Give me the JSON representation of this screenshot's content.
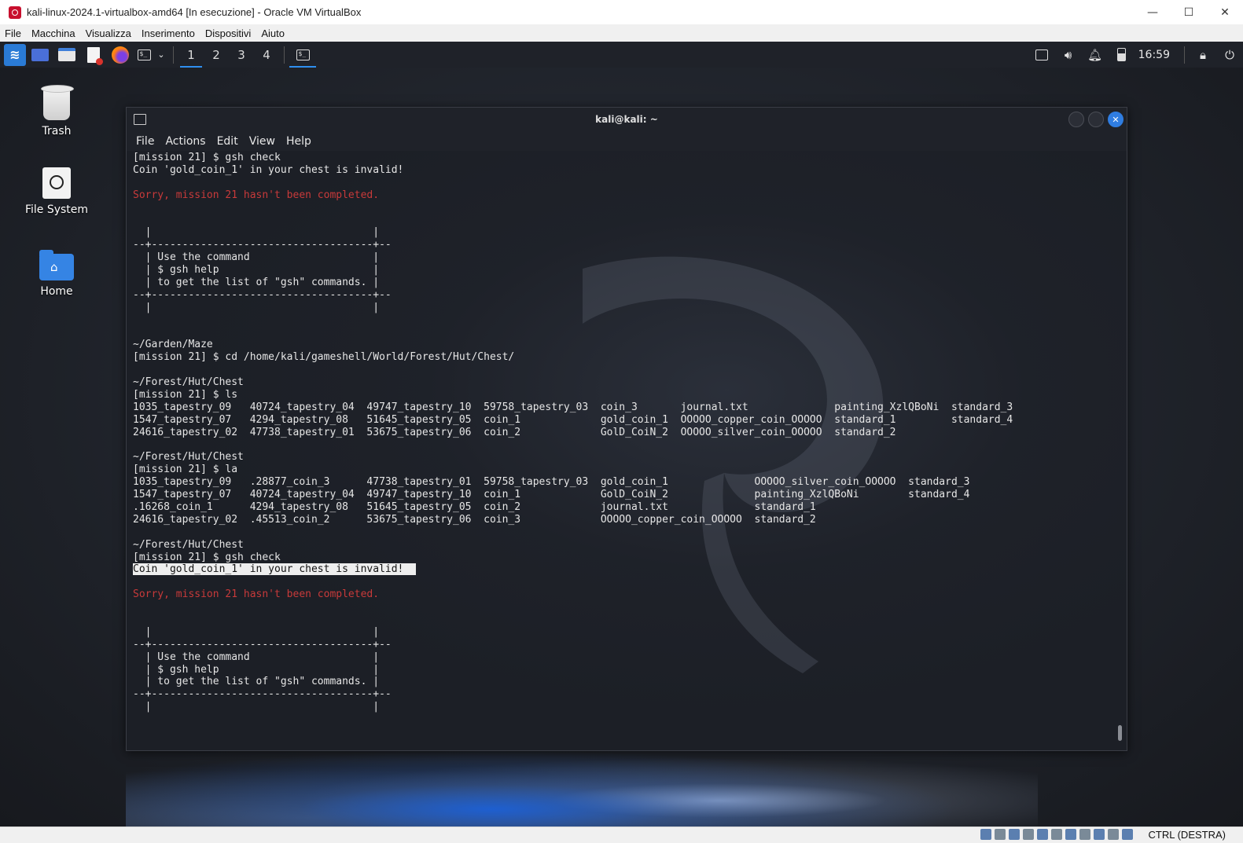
{
  "host_window": {
    "title": "kali-linux-2024.1-virtualbox-amd64 [In esecuzione] - Oracle VM VirtualBox",
    "controls": {
      "minimize": "—",
      "maximize": "☐",
      "close": "✕"
    },
    "menu": [
      "File",
      "Macchina",
      "Visualizza",
      "Inserimento",
      "Dispositivi",
      "Aiuto"
    ]
  },
  "panel": {
    "workspaces": [
      "1",
      "2",
      "3",
      "4"
    ],
    "active_workspace": "1",
    "clock": "16:59",
    "launchers": [
      "kali-menu-icon",
      "desktop-icon",
      "file-manager-icon",
      "text-editor-icon",
      "firefox-icon",
      "terminal-icon"
    ],
    "tray": [
      "network-icon",
      "volume-icon",
      "notifications-icon",
      "battery-icon",
      "lock-icon",
      "logout-icon"
    ]
  },
  "desktop_icons": [
    {
      "label": "Trash",
      "icon": "trash-icon"
    },
    {
      "label": "File System",
      "icon": "drive-icon"
    },
    {
      "label": "Home",
      "icon": "home-folder-icon"
    }
  ],
  "terminal": {
    "title": "kali@kali: ~",
    "menu": [
      "File",
      "Actions",
      "Edit",
      "View",
      "Help"
    ],
    "lines": [
      {
        "text": "[mission 21] $ gsh check"
      },
      {
        "text": "Coin 'gold_coin_1' in your chest is invalid!"
      },
      {
        "text": ""
      },
      {
        "text": "Sorry, mission 21 hasn't been completed.",
        "style": "red"
      },
      {
        "text": ""
      },
      {
        "text": ""
      },
      {
        "text": "  |                                    |"
      },
      {
        "text": "--+------------------------------------+--"
      },
      {
        "text": "  | Use the command                    |"
      },
      {
        "text": "  | $ gsh help                         |"
      },
      {
        "text": "  | to get the list of \"gsh\" commands. |"
      },
      {
        "text": "--+------------------------------------+--"
      },
      {
        "text": "  |                                    |"
      },
      {
        "text": ""
      },
      {
        "text": ""
      },
      {
        "text": "~/Garden/Maze"
      },
      {
        "text": "[mission 21] $ cd /home/kali/gameshell/World/Forest/Hut/Chest/"
      },
      {
        "text": ""
      },
      {
        "text": "~/Forest/Hut/Chest"
      },
      {
        "text": "[mission 21] $ ls"
      },
      {
        "text": "1035_tapestry_09   40724_tapestry_04  49747_tapestry_10  59758_tapestry_03  coin_3       journal.txt              painting_XzlQBoNi  standard_3"
      },
      {
        "text": "1547_tapestry_07   4294_tapestry_08   51645_tapestry_05  coin_1             gold_coin_1  OOOOO_copper_coin_OOOOO  standard_1         standard_4"
      },
      {
        "text": "24616_tapestry_02  47738_tapestry_01  53675_tapestry_06  coin_2             GolD_CoiN_2  OOOOO_silver_coin_OOOOO  standard_2"
      },
      {
        "text": ""
      },
      {
        "text": "~/Forest/Hut/Chest"
      },
      {
        "text": "[mission 21] $ la"
      },
      {
        "text": "1035_tapestry_09   .28877_coin_3      47738_tapestry_01  59758_tapestry_03  gold_coin_1              OOOOO_silver_coin_OOOOO  standard_3"
      },
      {
        "text": "1547_tapestry_07   40724_tapestry_04  49747_tapestry_10  coin_1             GolD_CoiN_2              painting_XzlQBoNi        standard_4"
      },
      {
        "text": ".16268_coin_1      4294_tapestry_08   51645_tapestry_05  coin_2             journal.txt              standard_1"
      },
      {
        "text": "24616_tapestry_02  .45513_coin_2      53675_tapestry_06  coin_3             OOOOO_copper_coin_OOOOO  standard_2"
      },
      {
        "text": ""
      },
      {
        "text": "~/Forest/Hut/Chest"
      },
      {
        "text": "[mission 21] $ gsh check"
      },
      {
        "text": "Coin 'gold_coin_1' in your chest is invalid!  ",
        "style": "selected"
      },
      {
        "text": ""
      },
      {
        "text": "Sorry, mission 21 hasn't been completed.",
        "style": "red"
      },
      {
        "text": ""
      },
      {
        "text": ""
      },
      {
        "text": "  |                                    |"
      },
      {
        "text": "--+------------------------------------+--"
      },
      {
        "text": "  | Use the command                    |"
      },
      {
        "text": "  | $ gsh help                         |"
      },
      {
        "text": "  | to get the list of \"gsh\" commands. |"
      },
      {
        "text": "--+------------------------------------+--"
      },
      {
        "text": "  |                                    |"
      }
    ]
  },
  "vb_status": {
    "host_key": "CTRL (DESTRA)"
  },
  "colors": {
    "error_text": "#c83a3a",
    "accent": "#2f8ff0",
    "terminal_bg": "#1c1f26",
    "close_button": "#2f7de1"
  }
}
